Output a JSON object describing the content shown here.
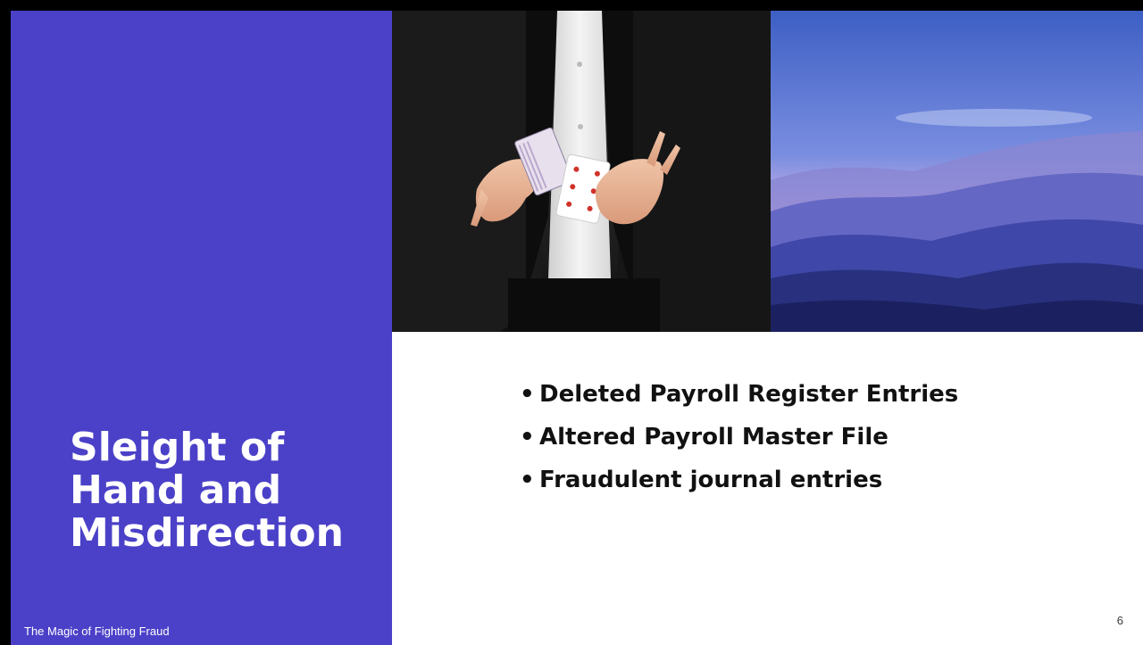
{
  "slide": {
    "title_lines": [
      "Sleight of",
      "Hand and",
      "Misdirection"
    ],
    "bullets": [
      "Deleted Payroll Register Entries",
      "Altered Payroll Master File",
      "Fraudulent journal entries"
    ],
    "footer": "The Magic of Fighting Fraud",
    "page_number": "6"
  },
  "images": {
    "left": "magician-shuffling-cards-photo",
    "right": "misty-mountains-photo"
  },
  "colors": {
    "accent": "#4b41c8",
    "text": "#111111",
    "background": "#ffffff"
  }
}
